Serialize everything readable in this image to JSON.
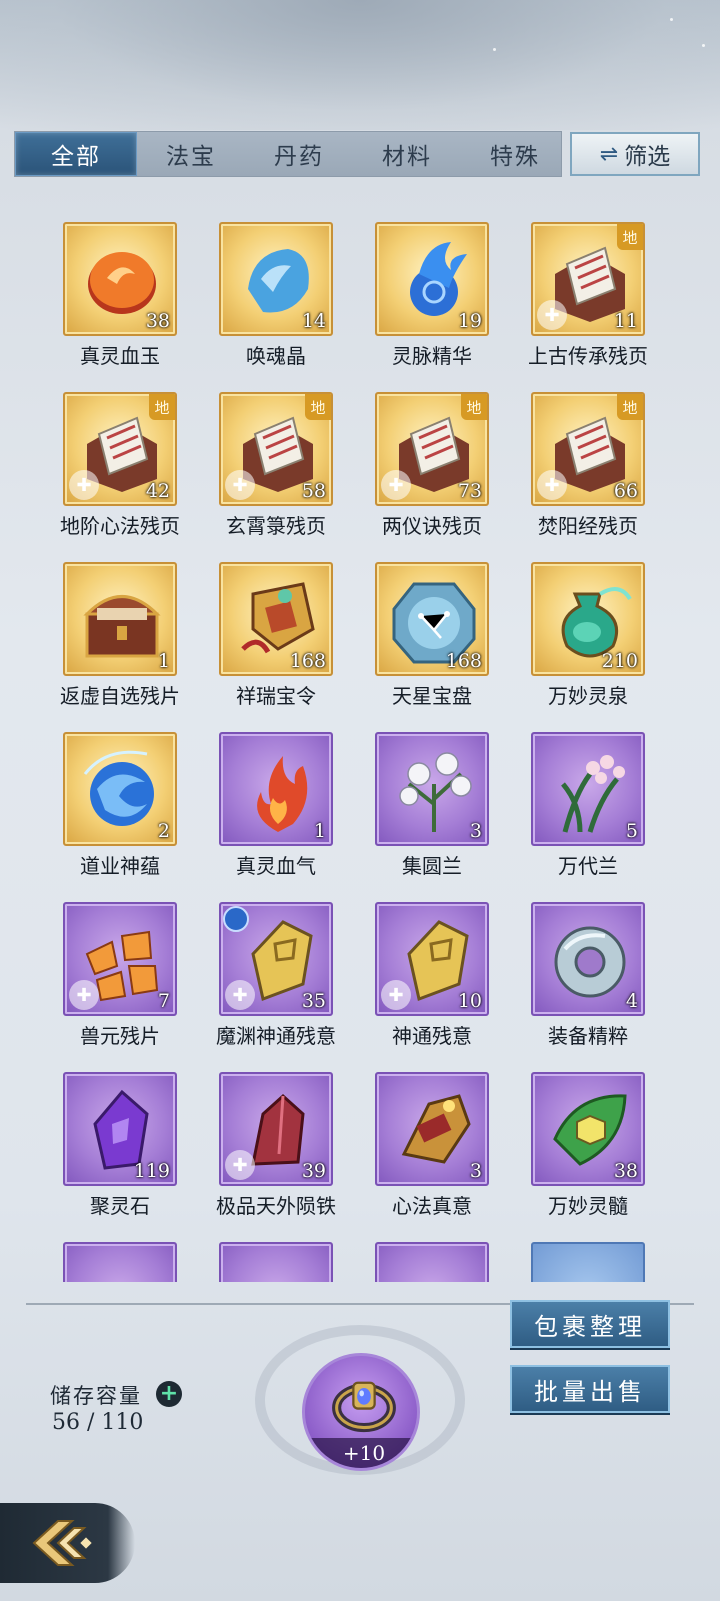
{
  "tabs": [
    {
      "label": "全部",
      "active": true
    },
    {
      "label": "法宝",
      "active": false
    },
    {
      "label": "丹药",
      "active": false
    },
    {
      "label": "材料",
      "active": false
    },
    {
      "label": "特殊",
      "active": false
    }
  ],
  "filter": {
    "label": "筛选",
    "icon": "swap-arrows-icon"
  },
  "items": [
    {
      "name": "真灵血玉",
      "count": "38",
      "rarity": "gold",
      "icon": "red-jade-disc-icon"
    },
    {
      "name": "唤魂晶",
      "count": "14",
      "rarity": "gold",
      "icon": "blue-crystal-icon"
    },
    {
      "name": "灵脉精华",
      "count": "19",
      "rarity": "gold",
      "icon": "blue-flame-orb-icon"
    },
    {
      "name": "上古传承残页",
      "count": "11",
      "rarity": "gold",
      "icon": "scroll-box-icon",
      "grade": "地",
      "fragment": true
    },
    {
      "name": "地阶心法残页",
      "count": "42",
      "rarity": "gold",
      "icon": "scroll-box-icon",
      "grade": "地",
      "fragment": true
    },
    {
      "name": "玄霄箓残页",
      "count": "58",
      "rarity": "gold",
      "icon": "scroll-box-icon",
      "grade": "地",
      "fragment": true
    },
    {
      "name": "两仪诀残页",
      "count": "73",
      "rarity": "gold",
      "icon": "scroll-box-icon",
      "grade": "地",
      "fragment": true
    },
    {
      "name": "焚阳经残页",
      "count": "66",
      "rarity": "gold",
      "icon": "scroll-box-icon",
      "grade": "地",
      "fragment": true
    },
    {
      "name": "返虚自选残片",
      "count": "1",
      "rarity": "gold",
      "icon": "treasure-chest-icon"
    },
    {
      "name": "祥瑞宝令",
      "count": "168",
      "rarity": "gold",
      "icon": "golden-token-icon"
    },
    {
      "name": "天星宝盘",
      "count": "168",
      "rarity": "gold",
      "icon": "star-disc-icon"
    },
    {
      "name": "万妙灵泉",
      "count": "210",
      "rarity": "gold",
      "icon": "green-vase-icon"
    },
    {
      "name": "道业神蕴",
      "count": "2",
      "rarity": "gold",
      "icon": "blue-swirl-orb-icon"
    },
    {
      "name": "真灵血气",
      "count": "1",
      "rarity": "purple",
      "icon": "red-flame-icon"
    },
    {
      "name": "集圆兰",
      "count": "3",
      "rarity": "purple",
      "icon": "white-orchid-icon"
    },
    {
      "name": "万代兰",
      "count": "5",
      "rarity": "purple",
      "icon": "pink-orchid-icon"
    },
    {
      "name": "兽元残片",
      "count": "7",
      "rarity": "purple",
      "icon": "orange-shards-icon",
      "fragment": true
    },
    {
      "name": "魔渊神通残意",
      "count": "35",
      "rarity": "purple",
      "icon": "golden-fragment-icon",
      "fragment": true,
      "emblem": true
    },
    {
      "name": "神通残意",
      "count": "10",
      "rarity": "purple",
      "icon": "golden-fragment-icon",
      "fragment": true
    },
    {
      "name": "装备精粹",
      "count": "4",
      "rarity": "purple",
      "icon": "jade-ring-icon"
    },
    {
      "name": "聚灵石",
      "count": "119",
      "rarity": "purple",
      "icon": "purple-gem-icon"
    },
    {
      "name": "极品天外陨铁",
      "count": "39",
      "rarity": "purple",
      "icon": "red-ore-icon",
      "fragment": true
    },
    {
      "name": "心法真意",
      "count": "3",
      "rarity": "purple",
      "icon": "golden-artifact-icon"
    },
    {
      "name": "万妙灵髓",
      "count": "38",
      "rarity": "purple",
      "icon": "green-leaf-gem-icon"
    },
    {
      "name": "",
      "count": "",
      "rarity": "purple",
      "icon": "partial-item-icon"
    },
    {
      "name": "",
      "count": "",
      "rarity": "purple",
      "icon": "partial-item-icon"
    },
    {
      "name": "",
      "count": "",
      "rarity": "purple",
      "icon": "partial-item-icon"
    },
    {
      "name": "",
      "count": "",
      "rarity": "blue",
      "icon": "partial-item-icon"
    }
  ],
  "storage": {
    "label": "储存容量",
    "value": "56 / 110"
  },
  "equip": {
    "plus": "+10",
    "icon": "ring-equipment-icon"
  },
  "actions": {
    "organize": "包裹整理",
    "sell": "批量出售"
  },
  "back": {
    "icon": "back-arrow-icon"
  }
}
